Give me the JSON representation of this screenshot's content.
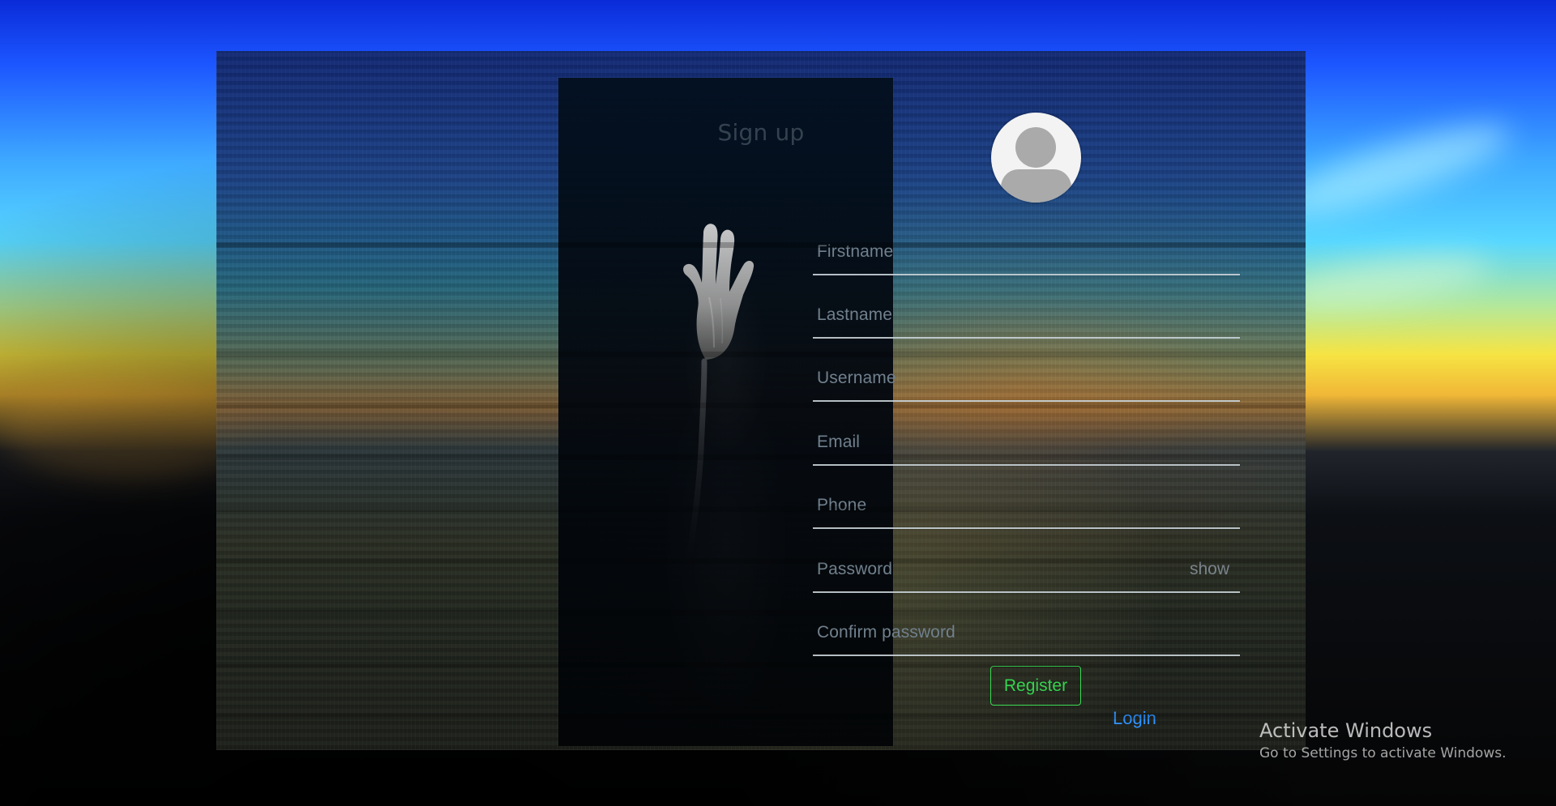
{
  "form": {
    "title": "Sign up",
    "fields": [
      {
        "label": "Firstname"
      },
      {
        "label": "Lastname"
      },
      {
        "label": "Username"
      },
      {
        "label": "Email"
      },
      {
        "label": "Phone"
      },
      {
        "label": "Password",
        "toggle": "show"
      },
      {
        "label": "Confirm password"
      }
    ],
    "register_label": "Register",
    "login_label": "Login"
  },
  "watermark": {
    "title": "Activate Windows",
    "subtitle": "Go to Settings to activate Windows."
  },
  "colors": {
    "register_accent": "#35d34f",
    "login_link": "#2f93ff"
  },
  "icons": {
    "avatar": "user-avatar-icon"
  }
}
